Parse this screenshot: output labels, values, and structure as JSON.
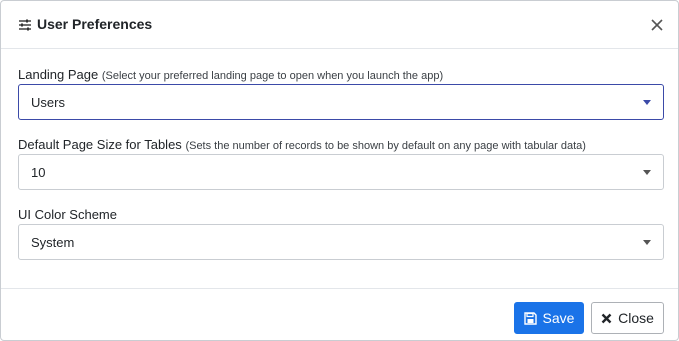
{
  "dialog": {
    "title": "User Preferences",
    "title_icon": "sliders-icon",
    "close_icon": "close-icon"
  },
  "fields": {
    "landing_page": {
      "label": "Landing Page",
      "hint": "(Select your preferred landing page to open when you launch the app)",
      "value": "Users"
    },
    "page_size": {
      "label": "Default Page Size for Tables",
      "hint": "(Sets the number of records to be shown by default on any page with tabular data)",
      "value": "10"
    },
    "color_scheme": {
      "label": "UI Color Scheme",
      "value": "System"
    }
  },
  "footer": {
    "save_label": "Save",
    "save_icon": "floppy-disk-icon",
    "close_label": "Close",
    "close_icon": "x-icon"
  },
  "colors": {
    "primary": "#1a73e8",
    "focus_border": "#3b4aa8"
  }
}
